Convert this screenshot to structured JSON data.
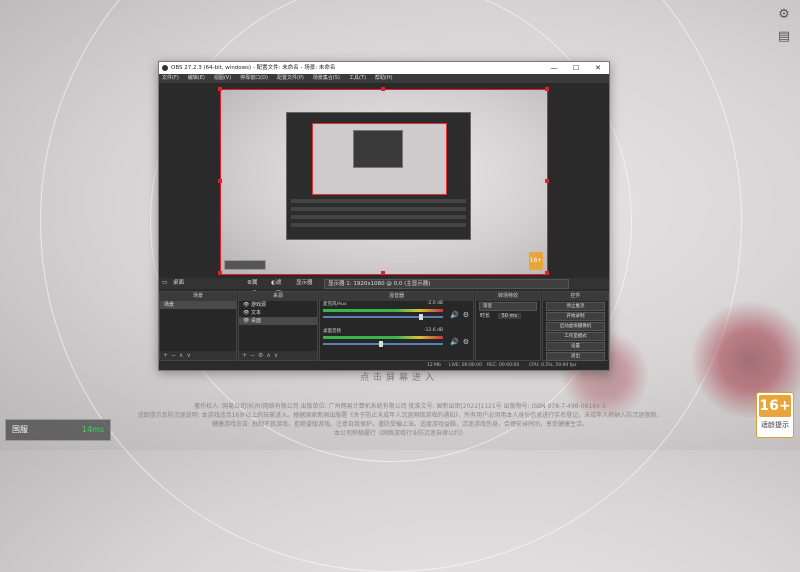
{
  "obs": {
    "title": "OBS 27.2.3 (64-bit, windows) - 配置文件: 未命名 - 场景: 未命名",
    "menu": [
      "文件(F)",
      "编辑(E)",
      "视图(V)",
      "停靠窗口(D)",
      "配置文件(P)",
      "场景集合(S)",
      "工具(T)",
      "帮助(H)"
    ],
    "toolbar": {
      "source": "桌面",
      "props": "属性",
      "filter": "滤镜",
      "display_label": "显示器",
      "display_value": "显示器 1: 1920x1080 @ 0,0 (主显示器)"
    },
    "panels": {
      "scenes": {
        "title": "场景",
        "items": [
          "场景"
        ]
      },
      "sources": {
        "title": "来源",
        "items": [
          "游戏源",
          "文本",
          "桌面"
        ]
      },
      "mixer": {
        "title": "混音器",
        "ch1": "麦克风/Aux",
        "ch1_db": "-2.0 dB",
        "ch2": "桌面音频",
        "ch2_db": "-12.6 dB"
      },
      "transitions": {
        "title": "转场特效",
        "type": "渐变",
        "duration_label": "时长",
        "duration": "50 ms"
      },
      "controls": {
        "title": "控件",
        "buttons": [
          "停止推流",
          "开始录制",
          "启动虚拟摄像机",
          "工作室模式",
          "设置",
          "退出"
        ]
      }
    },
    "status": {
      "live": "LIVE: 00:00:00",
      "rec": "REC: 00:00:00",
      "cpu": "CPU: 0.5%, 59.94 fps",
      "kbps": "12 Mb"
    }
  },
  "game": {
    "enter": "点击屏幕进入",
    "legal": [
      "著作权人: 网易公司(杭州)网络有限公司 出版单位: 广州网易计算机系统有限公司 批准文号: 国新出审[2022]1121号 出版物号: ISBN 978-7-498-08184-3",
      "适龄提示及防沉迷说明: 本游戏适合16岁以上的玩家进入。根据国家新闻出版署《关于防止未成年人沉迷网络游戏的通知》，所有用户必须用本人身份信息进行实名登记。未成年人将纳入防沉迷限制。",
      "健康游戏忠告: 抵制不良游戏，拒绝盗版游戏。注意自我保护，谨防受骗上当。适度游戏益脑，沉迷游戏伤身。合理安排时间，享受健康生活。",
      "本公司积极履行《网络游戏行业防沉迷自律公约》"
    ],
    "age_rating": "16+",
    "age_label": "适龄提示",
    "server_name": "国服",
    "latency": "14ms"
  },
  "icons": {
    "settings": "gear-icon",
    "fold": "fold-icon"
  }
}
